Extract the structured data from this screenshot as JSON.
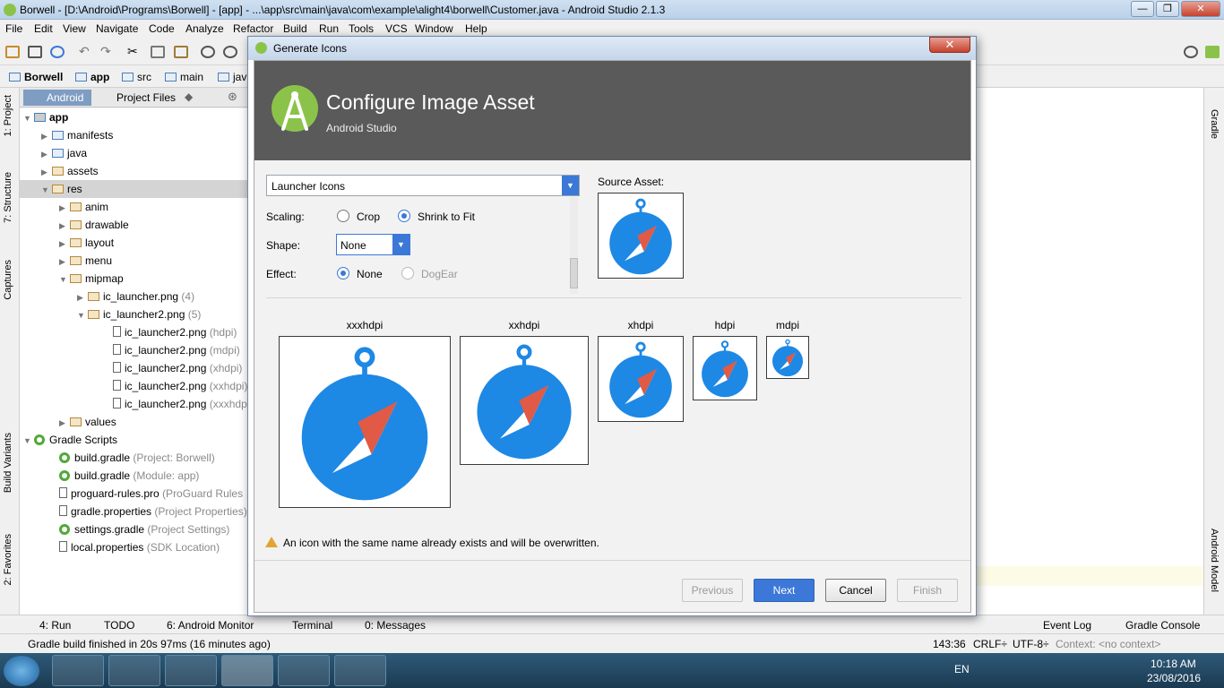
{
  "window": {
    "title": "Borwell - [D:\\Android\\Programs\\Borwell] - [app] - ...\\app\\src\\main\\java\\com\\example\\alight4\\borwell\\Customer.java - Android Studio 2.1.3",
    "min": "—",
    "max": "❐",
    "close": "✕"
  },
  "menu": [
    "File",
    "Edit",
    "View",
    "Navigate",
    "Code",
    "Analyze",
    "Refactor",
    "Build",
    "Run",
    "Tools",
    "VCS",
    "Window",
    "Help"
  ],
  "breadcrumbs": [
    "Borwell",
    "app",
    "src",
    "main",
    "java"
  ],
  "project_tabs": {
    "android": "Android",
    "files": "Project Files"
  },
  "left_tabs": {
    "project": "1: Project",
    "structure": "7: Structure",
    "captures": "Captures",
    "variants": "Build Variants",
    "favorites": "2: Favorites"
  },
  "right_tabs": {
    "gradle": "Gradle",
    "model": "Android Model"
  },
  "tree": {
    "app": "app",
    "manifests": "manifests",
    "java": "java",
    "assets": "assets",
    "res": "res",
    "anim": "anim",
    "drawable": "drawable",
    "layout": "layout",
    "menu": "menu",
    "mipmap": "mipmap",
    "ic1": "ic_launcher.png",
    "ic1_count": "(4)",
    "ic2": "ic_launcher2.png",
    "ic2_count": "(5)",
    "f1": "ic_launcher2.png",
    "f1q": "(hdpi)",
    "f2": "ic_launcher2.png",
    "f2q": "(mdpi)",
    "f3": "ic_launcher2.png",
    "f3q": "(xhdpi)",
    "f4": "ic_launcher2.png",
    "f4q": "(xxhdpi)",
    "f5": "ic_launcher2.png",
    "f5q": "(xxxhdpi)",
    "values": "values",
    "gradle_scripts": "Gradle Scripts",
    "g1": "build.gradle",
    "g1q": "(Project: Borwell)",
    "g2": "build.gradle",
    "g2q": "(Module: app)",
    "g3": "proguard-rules.pro",
    "g3q": "(ProGuard Rules",
    "g4": "gradle.properties",
    "g4q": "(Project Properties)",
    "g5": "settings.gradle",
    "g5q": "(Project Settings)",
    "g6": "local.properties",
    "g6q": "(SDK Location)"
  },
  "dialog": {
    "title": "Generate Icons",
    "close": "✕",
    "heading": "Configure Image Asset",
    "subheading": "Android Studio",
    "asset_type": "Launcher Icons",
    "scaling_label": "Scaling:",
    "crop": "Crop",
    "shrink": "Shrink to Fit",
    "shape_label": "Shape:",
    "shape_value": "None",
    "effect_label": "Effect:",
    "effect_none": "None",
    "effect_dogear": "DogEar",
    "source_label": "Source Asset:",
    "densities": [
      "xxxhdpi",
      "xxhdpi",
      "xhdpi",
      "hdpi",
      "mdpi"
    ],
    "warning": "An icon with the same name already exists and will be overwritten.",
    "buttons": {
      "previous": "Previous",
      "next": "Next",
      "cancel": "Cancel",
      "finish": "Finish"
    }
  },
  "bottom_tabs": {
    "run": "4: Run",
    "todo": "TODO",
    "monitor": "6: Android Monitor",
    "terminal": "Terminal",
    "messages": "0: Messages",
    "event_log": "Event Log",
    "gradle_console": "Gradle Console"
  },
  "status": {
    "message": "Gradle build finished in 20s 97ms (16 minutes ago)",
    "position": "143:36",
    "line_sep": "CRLF÷",
    "encoding": "UTF-8÷",
    "context": "Context: <no context>"
  },
  "tray": {
    "lang": "EN",
    "time": "10:18 AM",
    "date": "23/08/2016"
  },
  "colors": {
    "compass_blue": "#1e88e5",
    "needle_red": "#e05a45",
    "android_green": "#8bc34a",
    "accent": "#3c78d8"
  }
}
